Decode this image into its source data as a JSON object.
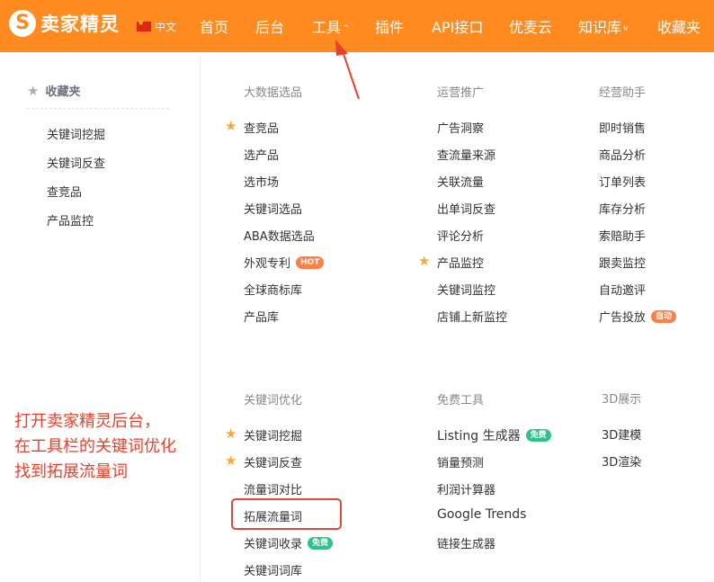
{
  "header": {
    "brand": "卖家精灵",
    "logo_letter": "S",
    "language": "中文",
    "nav": [
      {
        "label": "首页",
        "has_caret": false
      },
      {
        "label": "后台",
        "has_caret": false
      },
      {
        "label": "工具",
        "has_caret": true
      },
      {
        "label": "插件",
        "has_caret": false
      },
      {
        "label": "API接口",
        "has_caret": false
      },
      {
        "label": "优麦云",
        "has_caret": false
      },
      {
        "label": "知识库",
        "has_caret": true
      },
      {
        "label": "收藏夹",
        "has_caret": false
      }
    ]
  },
  "favorites": {
    "title": "收藏夹",
    "items": [
      "关键词挖掘",
      "关键词反查",
      "查竞品",
      "产品监控"
    ]
  },
  "menu": {
    "sections": [
      {
        "title": "大数据选品",
        "items": [
          {
            "label": "查竞品",
            "starred": true
          },
          {
            "label": "选产品"
          },
          {
            "label": "选市场"
          },
          {
            "label": "关键词选品"
          },
          {
            "label": "ABA数据选品"
          },
          {
            "label": "外观专利",
            "badge": "HOT"
          },
          {
            "label": "全球商标库"
          },
          {
            "label": "产品库"
          }
        ]
      },
      {
        "title": "运营推广",
        "items": [
          {
            "label": "广告洞察"
          },
          {
            "label": "查流量来源"
          },
          {
            "label": "关联流量"
          },
          {
            "label": "出单词反查"
          },
          {
            "label": "评论分析"
          },
          {
            "label": "产品监控",
            "starred": true
          },
          {
            "label": "关键词监控"
          },
          {
            "label": "店铺上新监控"
          }
        ]
      },
      {
        "title": "经营助手",
        "items": [
          {
            "label": "即时销售"
          },
          {
            "label": "商品分析"
          },
          {
            "label": "订单列表"
          },
          {
            "label": "库存分析"
          },
          {
            "label": "索赔助手"
          },
          {
            "label": "跟卖监控"
          },
          {
            "label": "自动邀评"
          },
          {
            "label": "广告投放",
            "badge": "自动"
          }
        ]
      },
      {
        "title": "关键词优化",
        "items": [
          {
            "label": "关键词挖掘",
            "starred": true
          },
          {
            "label": "关键词反查",
            "starred": true
          },
          {
            "label": "流量词对比"
          },
          {
            "label": "拓展流量词"
          },
          {
            "label": "关键词收录",
            "badge": "免费"
          },
          {
            "label": "关键词词库"
          }
        ]
      },
      {
        "title": "免费工具",
        "items": [
          {
            "label": "Listing 生成器",
            "badge": "免费"
          },
          {
            "label": "销量预测"
          },
          {
            "label": "利润计算器"
          },
          {
            "label": "Google Trends"
          },
          {
            "label": "链接生成器"
          }
        ]
      },
      {
        "title": "3D展示",
        "items": [
          {
            "label": "3D建模"
          },
          {
            "label": "3D渲染"
          }
        ]
      }
    ]
  },
  "annotation": {
    "lines": [
      "打开卖家精灵后台，",
      "在工具栏的关键词优化",
      "找到拓展流量词"
    ]
  },
  "colors": {
    "brand_orange": "#ff8a1f",
    "star": "#f7a93b",
    "badge_hot": "#ff7f47",
    "badge_free": "#2fc38a",
    "annotation_red": "#e8402d",
    "highlight_red": "#d94a3b"
  }
}
